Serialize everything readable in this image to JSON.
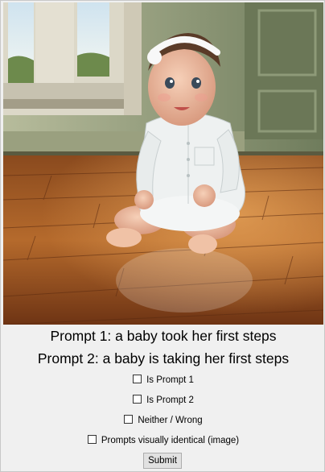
{
  "image": {
    "description_icon": "photo-baby-sitting-on-wooden-floor"
  },
  "prompts": {
    "prompt1": "Prompt 1: a baby took her first steps",
    "prompt2": "Prompt 2: a baby is taking her first steps"
  },
  "options": [
    {
      "label": "Is Prompt 1",
      "checked": false
    },
    {
      "label": "Is Prompt 2",
      "checked": false
    },
    {
      "label": "Neither / Wrong",
      "checked": false
    },
    {
      "label": "Prompts visually identical (image)",
      "checked": false
    }
  ],
  "submit_label": "Submit",
  "colors": {
    "background": "#f0f0f0",
    "button": "#e1e1e1",
    "text": "#000000"
  }
}
